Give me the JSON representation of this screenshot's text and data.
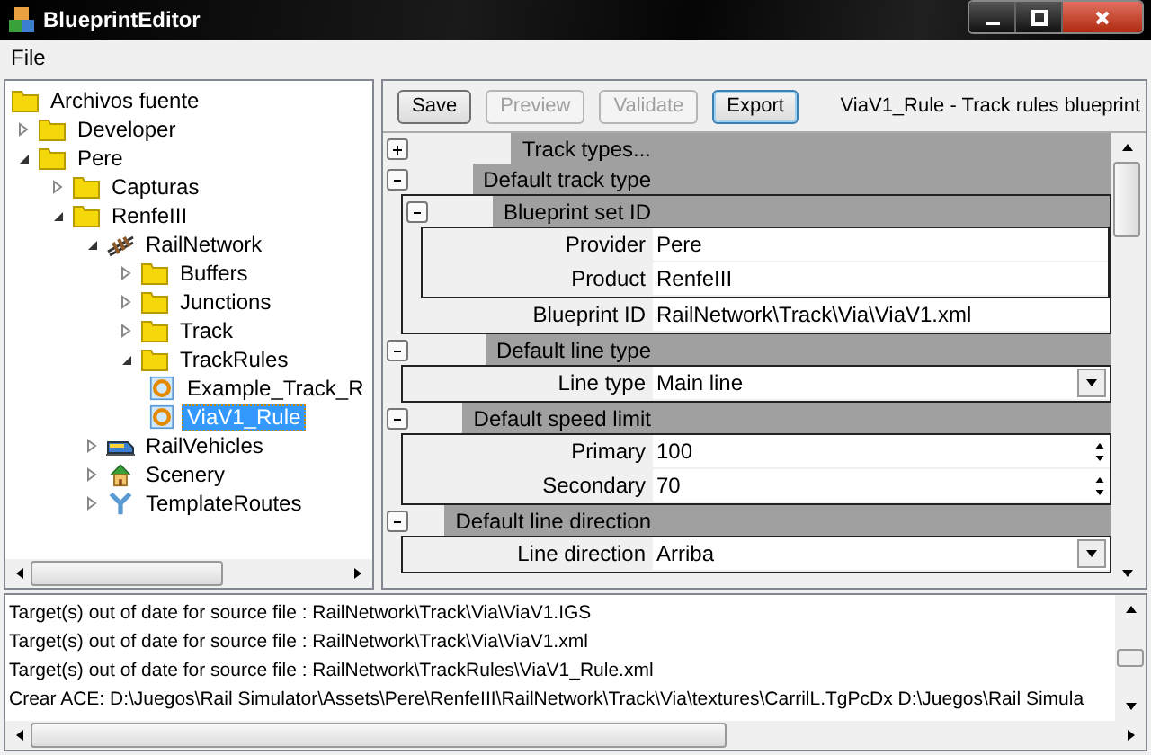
{
  "window": {
    "title": "BlueprintEditor"
  },
  "menu": [
    "File"
  ],
  "tree": [
    {
      "label": "Archivos fuente",
      "kind": "folder",
      "selected": false,
      "children": [
        {
          "label": "Developer",
          "kind": "folder",
          "selected": false,
          "expanded": false
        },
        {
          "label": "Pere",
          "kind": "folder",
          "selected": false,
          "expanded": true,
          "children": [
            {
              "label": "Capturas",
              "kind": "folder",
              "selected": false,
              "expanded": false
            },
            {
              "label": "RenfeIII",
              "kind": "folder",
              "selected": false,
              "expanded": true,
              "children": [
                {
                  "label": "RailNetwork",
                  "kind": "track",
                  "selected": false,
                  "expanded": true,
                  "children": [
                    {
                      "label": "Buffers",
                      "kind": "folder",
                      "selected": false,
                      "expanded": false
                    },
                    {
                      "label": "Junctions",
                      "kind": "folder",
                      "selected": false,
                      "expanded": false
                    },
                    {
                      "label": "Track",
                      "kind": "folder",
                      "selected": false,
                      "expanded": false
                    },
                    {
                      "label": "TrackRules",
                      "kind": "folder",
                      "selected": false,
                      "expanded": true,
                      "children": [
                        {
                          "label": "Example_Track_R",
                          "kind": "ring",
                          "selected": false
                        },
                        {
                          "label": "ViaV1_Rule",
                          "kind": "ring",
                          "selected": true
                        }
                      ]
                    }
                  ]
                },
                {
                  "label": "RailVehicles",
                  "kind": "train",
                  "selected": false,
                  "expanded": false
                },
                {
                  "label": "Scenery",
                  "kind": "house",
                  "selected": false,
                  "expanded": false
                },
                {
                  "label": "TemplateRoutes",
                  "kind": "pipe",
                  "selected": false,
                  "expanded": false
                }
              ]
            }
          ]
        }
      ]
    }
  ],
  "toolbar": {
    "buttons": [
      {
        "label": "Save",
        "disabled": false,
        "focused": false
      },
      {
        "label": "Preview",
        "disabled": true,
        "focused": false
      },
      {
        "label": "Validate",
        "disabled": true,
        "focused": false
      },
      {
        "label": "Export",
        "disabled": false,
        "focused": true
      }
    ],
    "title": "ViaV1_Rule - Track rules blueprint"
  },
  "property_grid": [
    {
      "kind": "category",
      "label": "Track types...",
      "expanded": false
    },
    {
      "kind": "category",
      "label": "Default track type",
      "expanded": true,
      "children": [
        {
          "kind": "category",
          "label": "Blueprint set ID",
          "expanded": true,
          "children": [
            {
              "kind": "text",
              "label": "Provider",
              "value": "Pere"
            },
            {
              "kind": "text",
              "label": "Product",
              "value": "RenfeIII"
            }
          ]
        },
        {
          "kind": "text",
          "label": "Blueprint ID",
          "value": "RailNetwork\\Track\\Via\\ViaV1.xml"
        }
      ]
    },
    {
      "kind": "category",
      "label": "Default line type",
      "expanded": true,
      "children": [
        {
          "kind": "dropdown",
          "label": "Line type",
          "value": "Main line"
        }
      ]
    },
    {
      "kind": "category",
      "label": "Default speed limit",
      "expanded": true,
      "children": [
        {
          "kind": "spin",
          "label": "Primary",
          "value": "100"
        },
        {
          "kind": "spin",
          "label": "Secondary",
          "value": "70"
        }
      ]
    },
    {
      "kind": "category",
      "label": "Default line direction",
      "expanded": true,
      "children": [
        {
          "kind": "dropdown",
          "label": "Line direction",
          "value": "Arriba"
        }
      ]
    }
  ],
  "log": [
    "Target(s) out of date for source file : RailNetwork\\Track\\Via\\ViaV1.IGS",
    "Target(s) out of date for source file : RailNetwork\\Track\\Via\\ViaV1.xml",
    "Target(s) out of date for source file : RailNetwork\\TrackRules\\ViaV1_Rule.xml",
    "Crear ACE: D:\\Juegos\\Rail Simulator\\Assets\\Pere\\RenfeIII\\RailNetwork\\Track\\Via\\textures\\CarrilL.TgPcDx D:\\Juegos\\Rail Simula"
  ]
}
